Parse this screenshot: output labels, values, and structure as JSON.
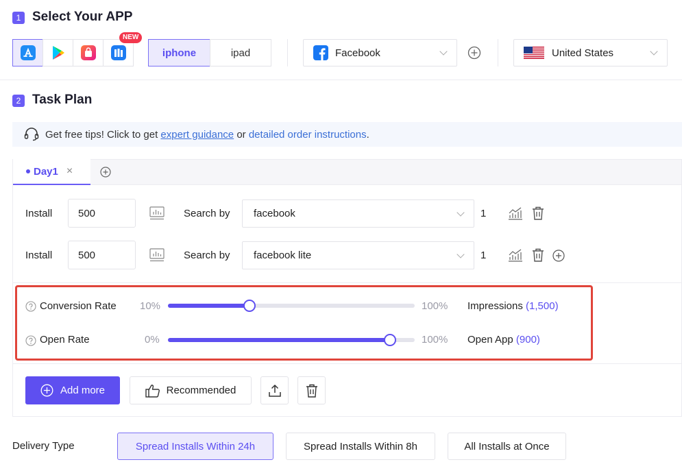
{
  "step1": {
    "number": "1",
    "title": "Select Your APP"
  },
  "stores": [
    {
      "name": "app-store-icon",
      "active": true
    },
    {
      "name": "google-play-icon",
      "active": false
    },
    {
      "name": "shop-bag-icon",
      "active": false
    },
    {
      "name": "store-library-icon",
      "active": false
    }
  ],
  "new_badge": "NEW",
  "devices": {
    "iphone": "iphone",
    "ipad": "ipad",
    "selected": "iphone"
  },
  "app_select": {
    "value": "Facebook",
    "icon": "facebook-icon"
  },
  "country_select": {
    "value": "United States",
    "icon": "us-flag-icon"
  },
  "step2": {
    "number": "2",
    "title": "Task Plan"
  },
  "tips": {
    "prefix": "Get free tips! Click to get ",
    "link1": "expert guidance",
    "middle": " or ",
    "link2": "detailed order instructions",
    "suffix": "."
  },
  "tabs": {
    "day": "Day1",
    "close": "×"
  },
  "rows": [
    {
      "install_label": "Install",
      "install_value": "500",
      "search_label": "Search by",
      "keyword": "facebook",
      "count": "1"
    },
    {
      "install_label": "Install",
      "install_value": "500",
      "search_label": "Search by",
      "keyword": "facebook lite",
      "count": "1"
    }
  ],
  "rates": [
    {
      "label": "Conversion Rate",
      "min": "10%",
      "max": "100%",
      "value": 0.33,
      "metric_label": "Impressions",
      "metric_value": "(1,500)"
    },
    {
      "label": "Open Rate",
      "min": "0%",
      "max": "100%",
      "value": 0.9,
      "metric_label": "Open App",
      "metric_value": "(900)"
    }
  ],
  "actions": {
    "add_more": "Add more",
    "recommended": "Recommended"
  },
  "delivery": {
    "label": "Delivery Type",
    "options": [
      "Spread Installs Within 24h",
      "Spread Installs Within 8h",
      "All Installs at Once"
    ],
    "selected": 0
  },
  "colors": {
    "accent": "#5e4ff0",
    "highlight": "#e0443a",
    "link": "#3b6fd6"
  }
}
